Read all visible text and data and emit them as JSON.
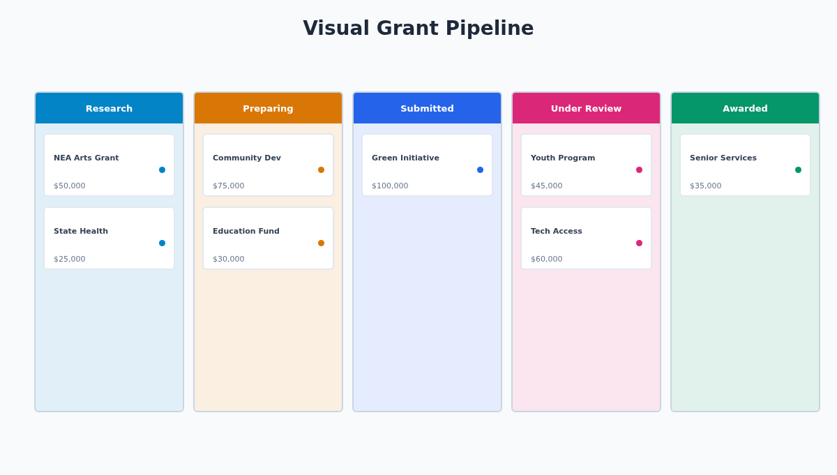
{
  "title": "Visual Grant Pipeline",
  "columns": [
    {
      "name": "Research",
      "color": "#0284c7",
      "cards": [
        {
          "name": "NEA Arts Grant",
          "amount": "$50,000"
        },
        {
          "name": "State Health",
          "amount": "$25,000"
        }
      ]
    },
    {
      "name": "Preparing",
      "color": "#d97706",
      "cards": [
        {
          "name": "Community Dev",
          "amount": "$75,000"
        },
        {
          "name": "Education Fund",
          "amount": "$30,000"
        }
      ]
    },
    {
      "name": "Submitted",
      "color": "#2563eb",
      "cards": [
        {
          "name": "Green Initiative",
          "amount": "$100,000"
        }
      ]
    },
    {
      "name": "Under Review",
      "color": "#db2777",
      "cards": [
        {
          "name": "Youth Program",
          "amount": "$45,000"
        },
        {
          "name": "Tech Access",
          "amount": "$60,000"
        }
      ]
    },
    {
      "name": "Awarded",
      "color": "#059669",
      "cards": [
        {
          "name": "Senior Services",
          "amount": "$35,000"
        }
      ]
    }
  ]
}
